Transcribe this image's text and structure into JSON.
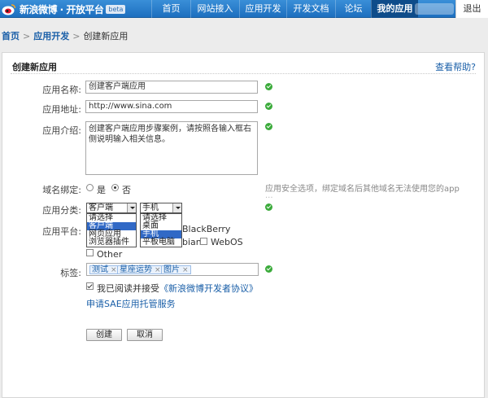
{
  "colors": {
    "navbar": "#2a80cf",
    "nav_active": "#0e4c8a",
    "link": "#1a5fa8",
    "ok": "#3bab3b"
  },
  "header": {
    "logo_text": "新浪微博 · 开放平台",
    "beta": "beta",
    "nav": [
      "首页",
      "网站接入",
      "应用开发",
      "开发文档",
      "论坛",
      "我的应用"
    ],
    "active_nav": "我的应用",
    "exit": "退出"
  },
  "breadcrumb": {
    "home": "首页",
    "dev": "应用开发",
    "current": "创建新应用",
    "sep": ">"
  },
  "panel": {
    "title": "创建新应用",
    "help": "查看帮助?"
  },
  "form": {
    "name_label": "应用名称:",
    "name_value": "创建客户端应用",
    "url_label": "应用地址:",
    "url_value": "http://www.sina.com",
    "desc_label": "应用介绍:",
    "desc_value": "创建客户端应用步骤案例，请按照各输入框右侧说明输入相关信息。",
    "domain_label": "域名绑定:",
    "domain_yes": "是",
    "domain_no": "否",
    "domain_selected": "否",
    "domain_hint": "应用安全选项，绑定域名后其他域名无法使用您的app",
    "category_label": "应用分类:",
    "category_value": "客户端",
    "category_options": [
      "请选择",
      "客户端",
      "网页应用",
      "浏览器插件"
    ],
    "category_highlight": "客户端",
    "device_value": "手机",
    "device_options": [
      "请选择",
      "桌面",
      "手机",
      "平板电脑"
    ],
    "device_highlight": "手机",
    "platform_label": "应用平台:",
    "platform_blackberry": "BlackBerry",
    "platform_symbian_partial": "bian",
    "platform_webos": "WebOS",
    "platform_other": "Other",
    "tags_label": "标签:",
    "tags": [
      "测试",
      "星座运势",
      "图片"
    ],
    "tag_close": "×",
    "agree_text": "我已阅读并接受",
    "agree_link": "《新浪微博开发者协议》",
    "sae_link": "申请SAE应用托管服务",
    "create_button": "创建",
    "cancel_button": "取消"
  }
}
